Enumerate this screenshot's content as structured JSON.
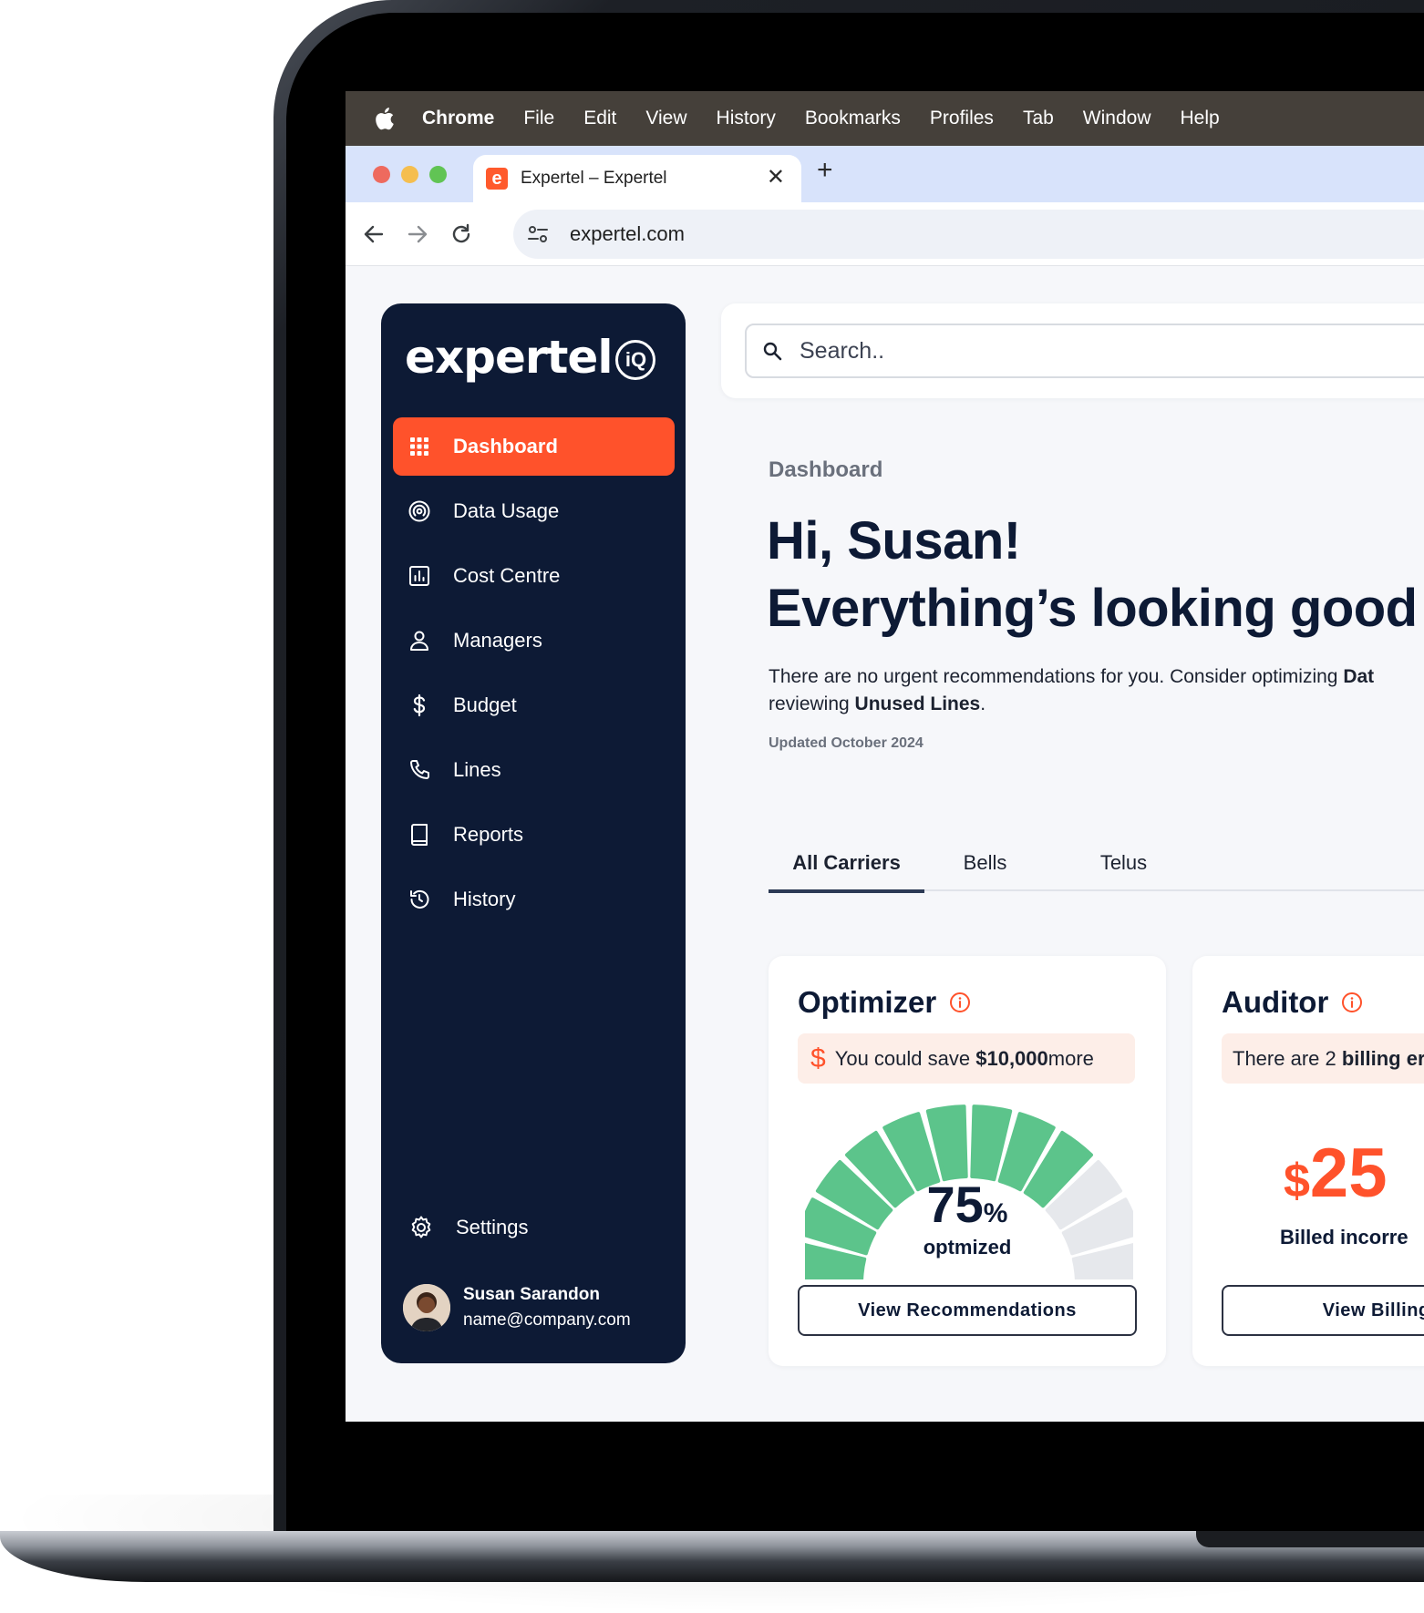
{
  "menubar": {
    "items": [
      "Chrome",
      "File",
      "Edit",
      "View",
      "History",
      "Bookmarks",
      "Profiles",
      "Tab",
      "Window",
      "Help"
    ]
  },
  "browser": {
    "tab_title": "Expertel – Expertel",
    "tab_favicon": "e",
    "close_glyph": "✕",
    "newtab_glyph": "+",
    "url": "expertel.com"
  },
  "sidebar": {
    "brand": "expertel",
    "brand_badge": "iQ",
    "items": [
      {
        "label": "Dashboard",
        "icon": "grid-icon",
        "active": true
      },
      {
        "label": "Data Usage",
        "icon": "signal-icon"
      },
      {
        "label": "Cost Centre",
        "icon": "bar-chart-icon"
      },
      {
        "label": "Managers",
        "icon": "user-icon"
      },
      {
        "label": "Budget",
        "icon": "dollar-icon"
      },
      {
        "label": "Lines",
        "icon": "phone-icon"
      },
      {
        "label": "Reports",
        "icon": "book-icon"
      },
      {
        "label": "History",
        "icon": "history-icon"
      }
    ],
    "settings_label": "Settings",
    "user": {
      "name": "Susan Sarandon",
      "email": "name@company.com"
    }
  },
  "search": {
    "placeholder": "Search.."
  },
  "main": {
    "breadcrumb": "Dashboard",
    "greeting_line1": "Hi, Susan!",
    "greeting_line2": "Everything’s looking good s",
    "reco_part1": "There are no urgent recommendations for you. Consider optimizing ",
    "reco_bold1": "Dat",
    "reco_part2": "reviewing ",
    "reco_bold2": "Unused Lines",
    "reco_part3": ".",
    "updated": "Updated October 2024"
  },
  "carrier_tabs": [
    {
      "label": "All Carriers",
      "active": true
    },
    {
      "label": "Bells"
    },
    {
      "label": "Telus"
    }
  ],
  "optimizer": {
    "title": "Optimizer",
    "pill_dollar": "$",
    "pill_text": "You could save ",
    "pill_bold": "$10,000",
    "pill_tail": " more",
    "gauge_percent": 75,
    "gauge_value": "75",
    "gauge_unit": "%",
    "gauge_label": "optmized",
    "button": "View Recommendations"
  },
  "auditor": {
    "title": "Auditor",
    "pill_text": "There are 2 ",
    "pill_bold": "billing err",
    "amount_currency": "$",
    "amount": "25",
    "sub": "Billed incorre",
    "button": "View Billing De"
  },
  "colors": {
    "accent": "#ff522b",
    "navy": "#0d1a35",
    "gauge_on": "#5cc48b",
    "gauge_off": "#e6e8ec"
  }
}
